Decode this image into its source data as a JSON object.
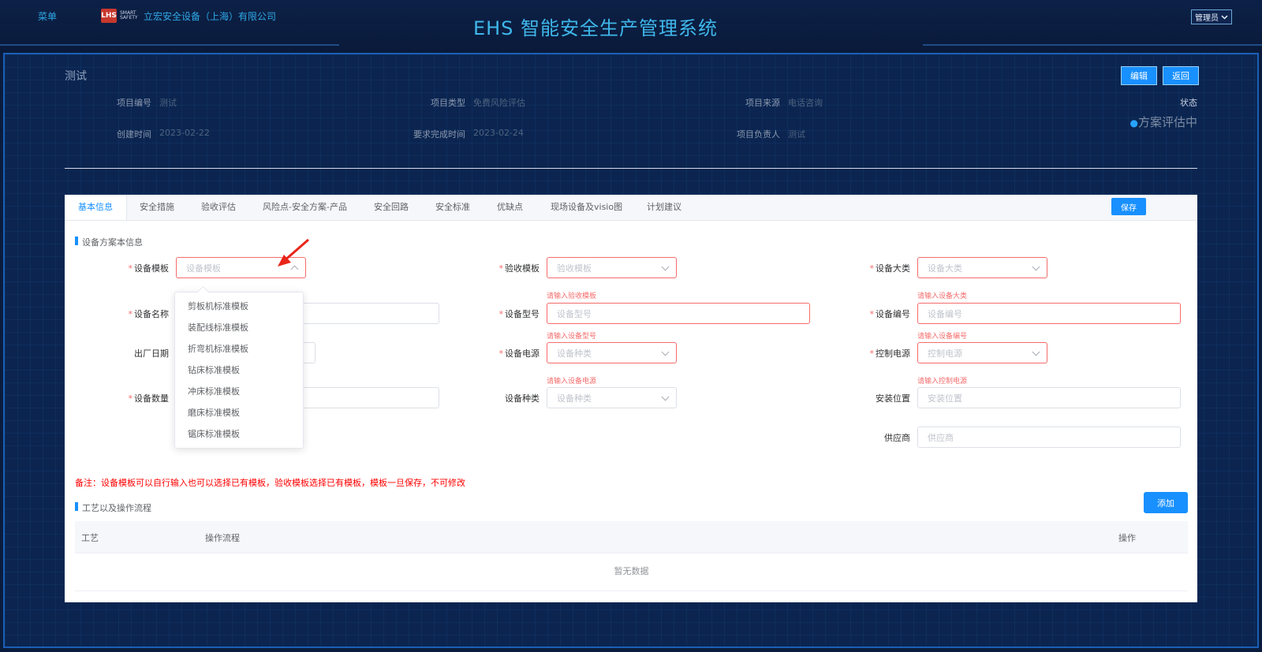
{
  "header": {
    "menu_label": "菜单",
    "logo_mark": "LHS",
    "logo_sub": "SMART SAFETY",
    "company": "立宏安全设备（上海）有限公司",
    "system_title": "EHS 智能安全生产管理系统",
    "user_label": "管理员"
  },
  "project": {
    "title": "测试",
    "edit_label": "编辑",
    "back_label": "返回",
    "fields": [
      {
        "label": "项目编号",
        "value": "测试"
      },
      {
        "label": "项目类型",
        "value": "免费风险评估"
      },
      {
        "label": "项目来源",
        "value": "电话咨询"
      },
      {
        "label": "创建时间",
        "value": "2023-02-22"
      },
      {
        "label": "要求完成时间",
        "value": "2023-02-24"
      },
      {
        "label": "项目负责人",
        "value": "测试"
      }
    ],
    "status_label": "状态",
    "status_value": "方案评估中",
    "status_dot": "●"
  },
  "tabs": [
    {
      "label": "基本信息"
    },
    {
      "label": "安全措施"
    },
    {
      "label": "验收评估"
    },
    {
      "label": "风险点-安全方案-产品"
    },
    {
      "label": "安全回路"
    },
    {
      "label": "安全标准"
    },
    {
      "label": "优缺点"
    },
    {
      "label": "现场设备及visio图"
    },
    {
      "label": "计划建议"
    }
  ],
  "save_label": "保存",
  "form": {
    "section_title": "设备方案本信息",
    "required_mark": "*",
    "fields": {
      "template": {
        "label": "设备模板",
        "placeholder": "设备模板"
      },
      "name": {
        "label": "设备名称",
        "placeholder": ""
      },
      "date": {
        "label": "出厂日期",
        "placeholder": ""
      },
      "quantity": {
        "label": "设备数量",
        "placeholder": ""
      },
      "accept_template": {
        "label": "验收模板",
        "placeholder": "验收模板",
        "error": "请输入验收模板"
      },
      "model": {
        "label": "设备型号",
        "placeholder": "设备型号",
        "error": "请输入设备型号"
      },
      "power": {
        "label": "设备电源",
        "placeholder": "设备种类",
        "error": "请输入设备电源"
      },
      "kind": {
        "label": "设备种类",
        "placeholder": "设备种类"
      },
      "category": {
        "label": "设备大类",
        "placeholder": "设备大类",
        "error": "请输入设备大类"
      },
      "number": {
        "label": "设备编号",
        "placeholder": "设备编号",
        "error": "请输入设备编号"
      },
      "control_power": {
        "label": "控制电源",
        "placeholder": "控制电源",
        "error": "请输入控制电源"
      },
      "location": {
        "label": "安装位置",
        "placeholder": "安装位置"
      },
      "supplier": {
        "label": "供应商",
        "placeholder": "供应商"
      }
    },
    "template_options": [
      "剪板机标准模板",
      "装配线标准模板",
      "折弯机标准模板",
      "钻床标准模板",
      "冲床标准模板",
      "磨床标准模板",
      "锯床标准模板"
    ],
    "note": "备注：设备模板可以自行输入也可以选择已有模板，验收模板选择已有模板，模板一旦保存，不可修改"
  },
  "process": {
    "section_title": "工艺以及操作流程",
    "add_label": "添加",
    "columns": [
      "工艺",
      "操作流程",
      "操作"
    ],
    "empty_text": "暂无数据"
  },
  "colors": {
    "accent": "#1890ff",
    "error": "#f56c6c",
    "background": "#0b2550"
  }
}
